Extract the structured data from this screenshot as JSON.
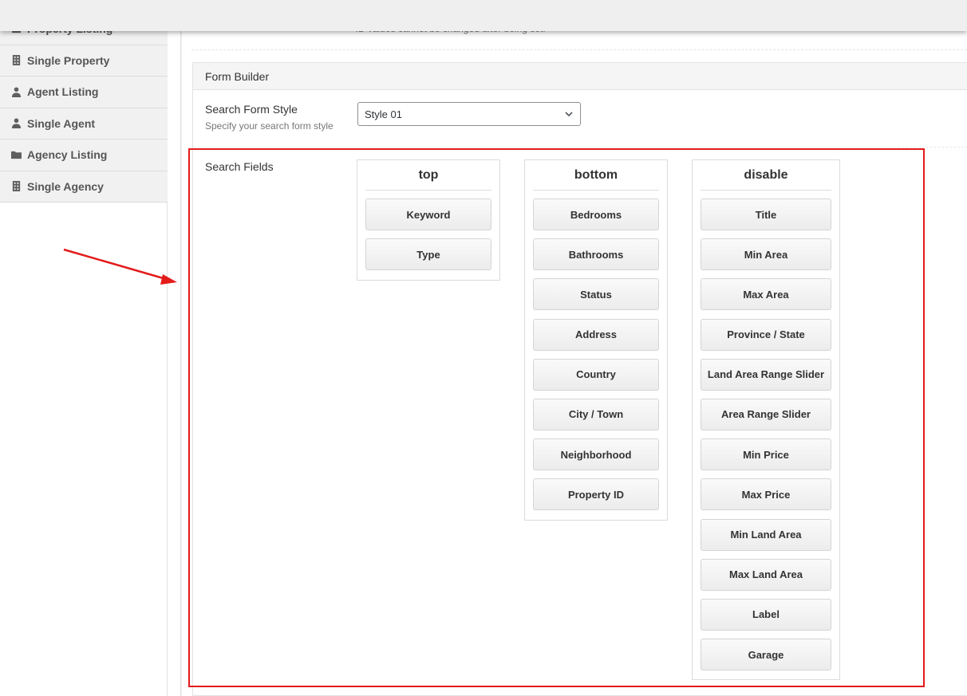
{
  "sidebar": {
    "items": [
      {
        "label": "Property Listing",
        "icon": "building-list-icon"
      },
      {
        "label": "Single Property",
        "icon": "building-icon"
      },
      {
        "label": "Agent Listing",
        "icon": "user-icon"
      },
      {
        "label": "Single Agent",
        "icon": "user-icon"
      },
      {
        "label": "Agency Listing",
        "icon": "folder-icon"
      },
      {
        "label": "Single Agency",
        "icon": "building-icon"
      }
    ]
  },
  "main": {
    "id_hint": "ID values cannot be changed after being set.",
    "form_builder": {
      "title": "Form Builder",
      "search_form_style": {
        "label": "Search Form Style",
        "description": "Specify your search form style",
        "selected": "Style 01"
      },
      "search_fields": {
        "label": "Search Fields",
        "columns": [
          {
            "title": "top",
            "fields": [
              "Keyword",
              "Type"
            ]
          },
          {
            "title": "bottom",
            "fields": [
              "Bedrooms",
              "Bathrooms",
              "Status",
              "Address",
              "Country",
              "City / Town",
              "Neighborhood",
              "Property ID"
            ]
          },
          {
            "title": "disable",
            "fields": [
              "Title",
              "Min Area",
              "Max Area",
              "Province / State",
              "Land Area Range Slider",
              "Area Range Slider",
              "Min Price",
              "Max Price",
              "Min Land Area",
              "Max Land Area",
              "Label",
              "Garage"
            ]
          }
        ]
      }
    }
  },
  "annotation": {
    "highlight_color": "#e31b1b"
  }
}
